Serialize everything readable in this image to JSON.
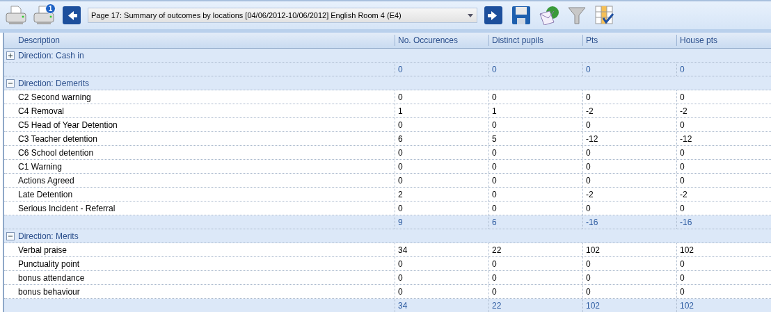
{
  "toolbar": {
    "print_badge": "1",
    "report_selector": {
      "value": "Page 17: Summary of outcomes by locations [04/06/2012-10/06/2012] English Room 4 (E4)"
    }
  },
  "table": {
    "columns": [
      "Description",
      "No. Occurences",
      "Distinct pupils",
      "Pts",
      "House pts"
    ],
    "groups": [
      {
        "label": "Direction: Cash in",
        "expanded": false,
        "totals": [
          "0",
          "0",
          "0",
          "0"
        ]
      },
      {
        "label": "Direction: Demerits",
        "expanded": true,
        "rows": [
          {
            "description": "C2 Second warning",
            "values": [
              "0",
              "0",
              "0",
              "0"
            ]
          },
          {
            "description": "C4 Removal",
            "values": [
              "1",
              "1",
              "-2",
              "-2"
            ]
          },
          {
            "description": "C5 Head of Year Detention",
            "values": [
              "0",
              "0",
              "0",
              "0"
            ]
          },
          {
            "description": "C3 Teacher detention",
            "values": [
              "6",
              "5",
              "-12",
              "-12"
            ]
          },
          {
            "description": "C6 School detention",
            "values": [
              "0",
              "0",
              "0",
              "0"
            ]
          },
          {
            "description": "C1 Warning",
            "values": [
              "0",
              "0",
              "0",
              "0"
            ]
          },
          {
            "description": "Actions Agreed",
            "values": [
              "0",
              "0",
              "0",
              "0"
            ]
          },
          {
            "description": "Late Detention",
            "values": [
              "2",
              "0",
              "-2",
              "-2"
            ]
          },
          {
            "description": "Serious Incident - Referral",
            "values": [
              "0",
              "0",
              "0",
              "0"
            ]
          }
        ],
        "totals": [
          "9",
          "6",
          "-16",
          "-16"
        ]
      },
      {
        "label": "Direction: Merits",
        "expanded": true,
        "rows": [
          {
            "description": "Verbal praise",
            "values": [
              "34",
              "22",
              "102",
              "102"
            ]
          },
          {
            "description": "Punctuality point",
            "values": [
              "0",
              "0",
              "0",
              "0"
            ]
          },
          {
            "description": "bonus attendance",
            "values": [
              "0",
              "0",
              "0",
              "0"
            ]
          },
          {
            "description": "bonus behaviour",
            "values": [
              "0",
              "0",
              "0",
              "0"
            ]
          }
        ],
        "totals": [
          "34",
          "22",
          "102",
          "102"
        ]
      }
    ]
  }
}
